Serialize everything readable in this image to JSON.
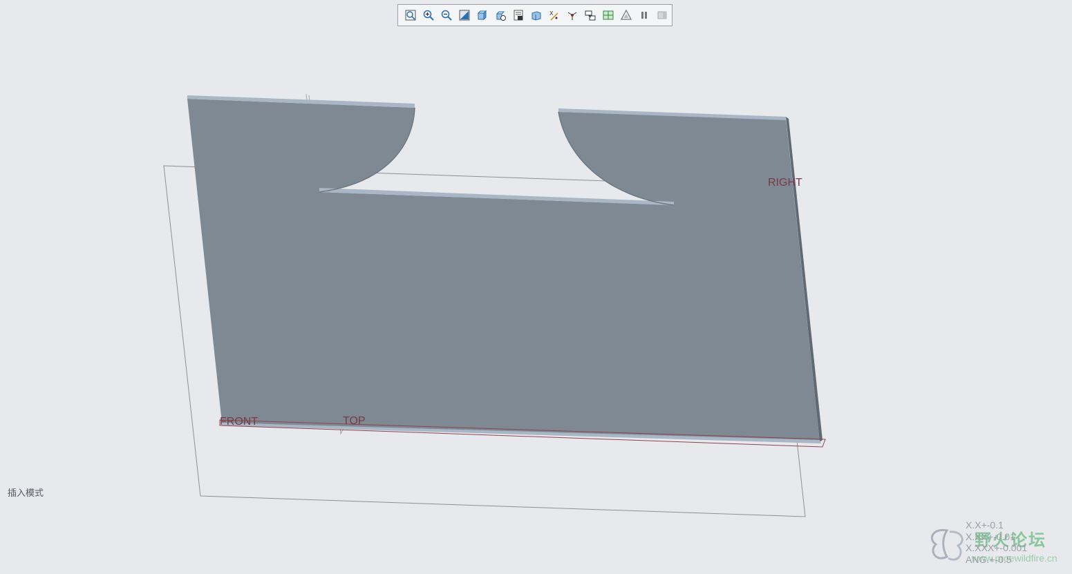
{
  "toolbar": {
    "tools": [
      {
        "name": "refit-icon"
      },
      {
        "name": "zoom-in-icon"
      },
      {
        "name": "zoom-out-icon"
      },
      {
        "name": "repaint-icon"
      },
      {
        "name": "display-style-icon"
      },
      {
        "name": "saved-orientations-icon"
      },
      {
        "name": "view-manager-icon"
      },
      {
        "name": "perspective-view-icon"
      },
      {
        "name": "datum-display-filters-icon"
      },
      {
        "name": "spin-center-icon"
      },
      {
        "name": "annotation-display-icon"
      },
      {
        "name": "section-icon"
      },
      {
        "name": "appearance-icon"
      },
      {
        "name": "pause-icon"
      },
      {
        "name": "disabled-tool-icon"
      }
    ]
  },
  "datums": {
    "right": "RIGHT",
    "front": "FRONT",
    "top": "TOP"
  },
  "status": {
    "mode": "插入模式"
  },
  "tolerances": {
    "line1": "X.X+-0.1",
    "line2": "X.XX+-0.01",
    "line3": "X.XXX+-0.001",
    "line4": "ANG.+-0.5"
  },
  "watermark": {
    "title": "野火论坛",
    "url": "www.proewildfire.cn"
  },
  "colors": {
    "background": "#e8e9ec",
    "part_face": "#7e8994",
    "part_edge": "#a9b6c5",
    "datum_label": "#7a3a44"
  }
}
